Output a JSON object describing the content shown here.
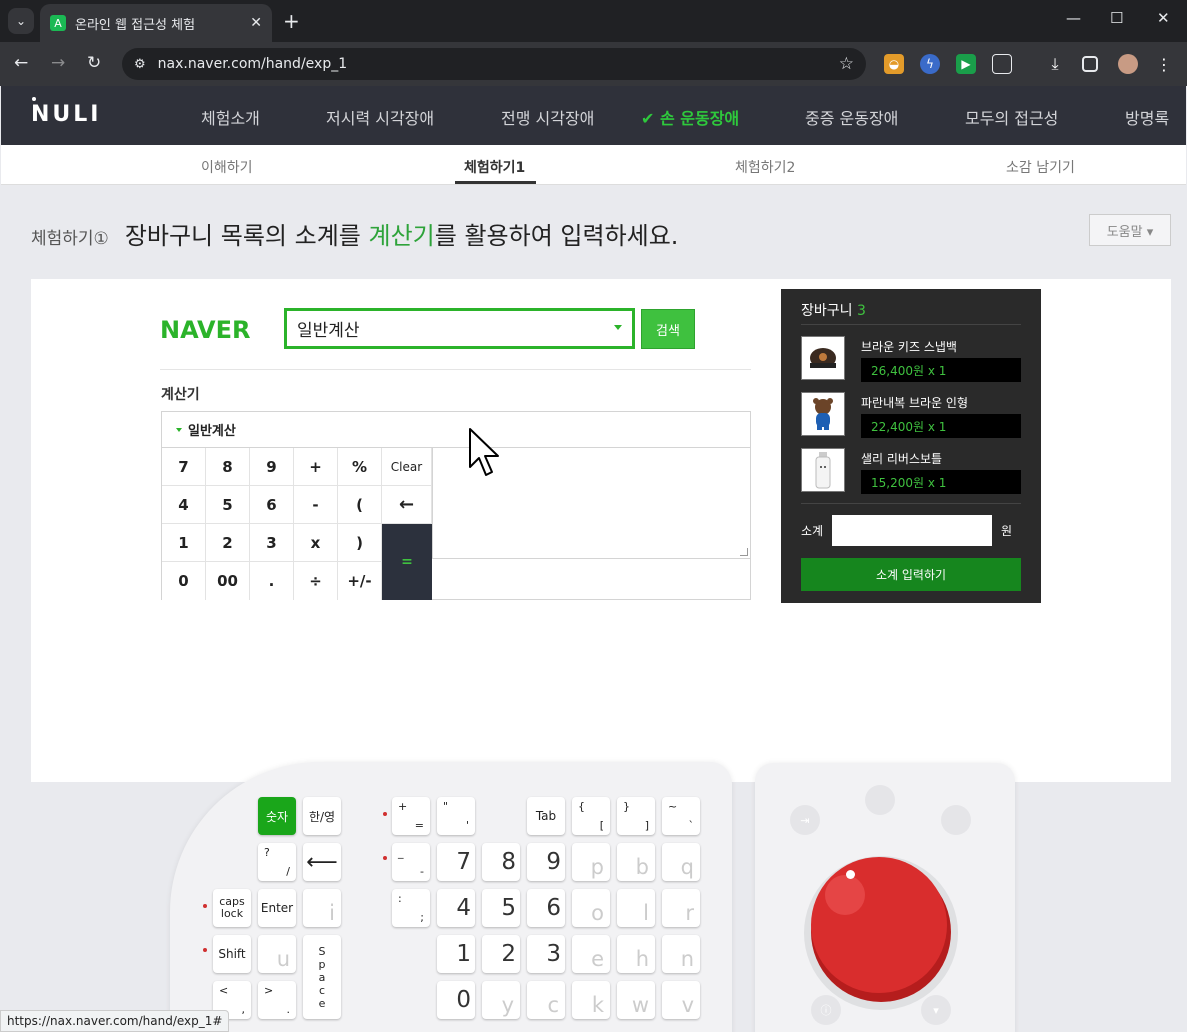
{
  "browser": {
    "tab_title": "온라인 웹 접근성 체험",
    "url": "nax.naver.com/hand/exp_1",
    "status_url": "https://nax.naver.com/hand/exp_1#"
  },
  "site": {
    "logo": "NULI",
    "nav": [
      "체험소개",
      "저시력 시각장애",
      "전맹 시각장애",
      "손 운동장애",
      "중증 운동장애",
      "모두의 접근성",
      "방명록"
    ],
    "active_nav": "손 운동장애",
    "subnav": [
      "이해하기",
      "체험하기1",
      "체험하기2",
      "소감 남기기"
    ],
    "active_subnav": "체험하기1"
  },
  "task": {
    "step": "체험하기①",
    "text_before": "장바구니 목록의 소계를 ",
    "highlight": "계산기",
    "text_after": "를 활용하여 입력하세요.",
    "help": "도움말 ▾"
  },
  "search": {
    "brand": "NAVER",
    "query": "일반계산",
    "button": "검색"
  },
  "calculator": {
    "label": "계산기",
    "mode": "일반계산",
    "keys": [
      [
        "7",
        "8",
        "9",
        "+",
        "%",
        "Clear"
      ],
      [
        "4",
        "5",
        "6",
        "-",
        "(",
        "←"
      ],
      [
        "1",
        "2",
        "3",
        "x",
        ")"
      ],
      [
        "0",
        "00",
        ".",
        "÷",
        "+/-"
      ]
    ],
    "equals": "="
  },
  "cart": {
    "title": "장바구니",
    "count": "3",
    "items": [
      {
        "name": "브라운 키즈 스냅백",
        "price": "26,400원 x 1",
        "icon": "cap-icon"
      },
      {
        "name": "파란내복 브라운 인형",
        "price": "22,400원 x 1",
        "icon": "bear-doll-icon"
      },
      {
        "name": "샐리 리버스보틀",
        "price": "15,200원 x 1",
        "icon": "bottle-icon"
      }
    ],
    "subtotal_label": "소계",
    "currency": "원",
    "submit": "소계 입력하기"
  },
  "keyboard": {
    "keys": {
      "num": "숫자",
      "lang": "한/영",
      "caps": "caps lock",
      "enter": "Enter",
      "shift": "Shift",
      "tab": "Tab",
      "space": "Space",
      "n7": "7",
      "n8": "8",
      "n9": "9",
      "n4": "4",
      "n5": "5",
      "n6": "6",
      "n1": "1",
      "n2": "2",
      "n3": "3",
      "n0": "0",
      "p": "p",
      "b": "b",
      "q": "q",
      "o": "o",
      "l": "l",
      "r": "r",
      "e": "e",
      "h": "h",
      "n": "n",
      "y": "y",
      "c": "c",
      "k": "k",
      "w": "w",
      "v": "v",
      "i": "i",
      "u": "u"
    }
  },
  "colors": {
    "accent_green": "#2bb32a",
    "header_bg": "#2f313a",
    "cart_bg": "#2a2a2a",
    "joystick_red": "#d92d2d"
  }
}
